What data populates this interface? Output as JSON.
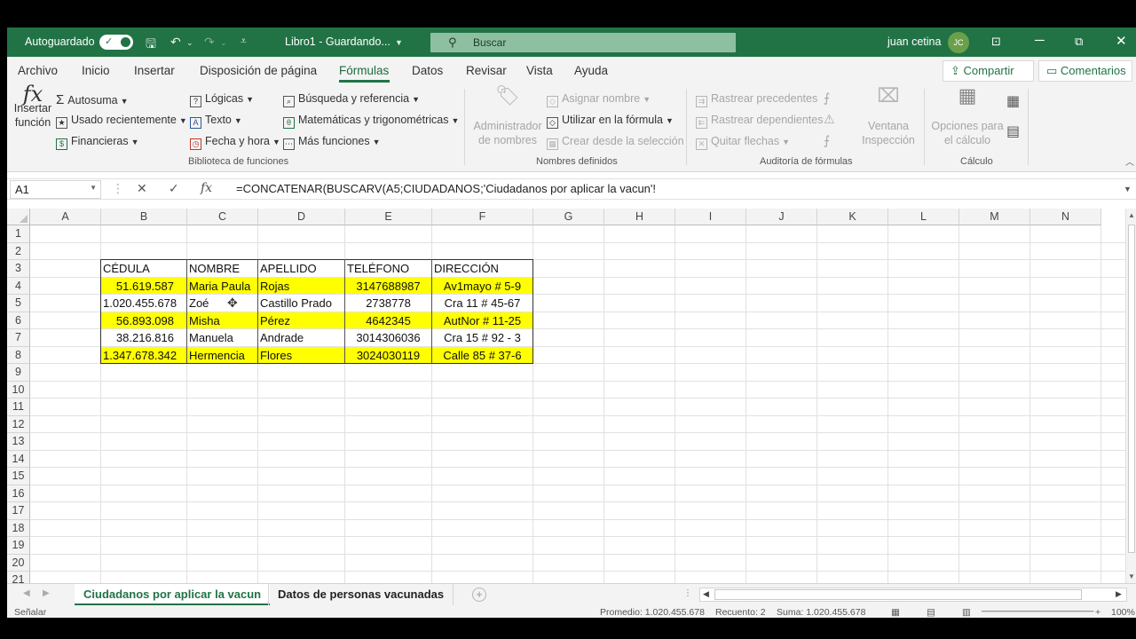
{
  "titlebar": {
    "autosave_label": "Autoguardado",
    "doc_name": "Libro1 - Guardando...",
    "search_placeholder": "Buscar",
    "user_name": "juan cetina",
    "user_initials": "JC",
    "brand_color": "#217346"
  },
  "tabs": [
    "Archivo",
    "Inicio",
    "Insertar",
    "Disposición de página",
    "Fórmulas",
    "Datos",
    "Revisar",
    "Vista",
    "Ayuda"
  ],
  "active_tab": "Fórmulas",
  "share_label": "Compartir",
  "comments_label": "Comentarios",
  "ribbon": {
    "insert_function": [
      "Insertar",
      "función"
    ],
    "library": {
      "autosum": "Autosuma",
      "recent": "Usado recientemente",
      "financial": "Financieras",
      "logical": "Lógicas",
      "text": "Texto",
      "datetime": "Fecha y hora",
      "lookup": "Búsqueda y referencia",
      "math": "Matemáticas y trigonométricas",
      "more": "Más funciones",
      "group_label": "Biblioteca de funciones"
    },
    "names": {
      "manager": [
        "Administrador",
        "de nombres"
      ],
      "define": "Asignar nombre",
      "use": "Utilizar en la fórmula",
      "create": "Crear desde la selección",
      "group_label": "Nombres definidos"
    },
    "audit": {
      "precedents": "Rastrear precedentes",
      "dependents": "Rastrear dependientes",
      "remove": "Quitar flechas",
      "watch": [
        "Ventana",
        "Inspección"
      ],
      "group_label": "Auditoría de fórmulas"
    },
    "calc": {
      "options": [
        "Opciones para",
        "el cálculo"
      ],
      "group_label": "Cálculo"
    }
  },
  "formula_bar": {
    "name_box": "A1",
    "formula": "=CONCATENAR(BUSCARV(A5;CIUDADANOS;'Ciudadanos por aplicar la vacun'!"
  },
  "columns": [
    "A",
    "B",
    "C",
    "D",
    "E",
    "F",
    "G",
    "H",
    "I",
    "J",
    "K",
    "L",
    "M",
    "N"
  ],
  "rows": [
    "1",
    "2",
    "3",
    "4",
    "5",
    "6",
    "7",
    "8",
    "9",
    "10",
    "11",
    "12",
    "13",
    "14",
    "15",
    "16",
    "17",
    "18",
    "19",
    "20",
    "21"
  ],
  "table": {
    "headers": [
      "CÉDULA",
      "NOMBRE",
      "APELLIDO",
      "TELÉFONO",
      "DIRECCIÓN"
    ],
    "rows": [
      {
        "cedula": "51.619.587",
        "nombre": "Maria Paula",
        "apellido": "Rojas",
        "telefono": "3147688987",
        "direccion": "Av1mayo # 5-9",
        "highlight": true
      },
      {
        "cedula": "1.020.455.678",
        "nombre": "Zoé",
        "apellido": "Castillo Prado",
        "telefono": "2738778",
        "direccion": "Cra 11 # 45-67",
        "highlight": false
      },
      {
        "cedula": "56.893.098",
        "nombre": "Misha",
        "apellido": "Pérez",
        "telefono": "4642345",
        "direccion": "AutNor # 11-25",
        "highlight": true
      },
      {
        "cedula": "38.216.816",
        "nombre": "Manuela",
        "apellido": "Andrade",
        "telefono": "3014306036",
        "direccion": "Cra 15 # 92 - 3",
        "highlight": false
      },
      {
        "cedula": "1.347.678.342",
        "nombre": "Hermencia",
        "apellido": "Flores",
        "telefono": "3024030119",
        "direccion": "Calle 85 # 37-6",
        "highlight": true
      }
    ],
    "highlight_color": "#ffff00"
  },
  "sheets": {
    "active": "Ciudadanos por aplicar la vacun",
    "other": "Datos de personas vacunadas"
  },
  "status": {
    "mode": "Señalar",
    "average": "Promedio: 1.020.455.678",
    "count": "Recuento: 2",
    "sum": "Suma: 1.020.455.678",
    "zoom": "100%"
  }
}
